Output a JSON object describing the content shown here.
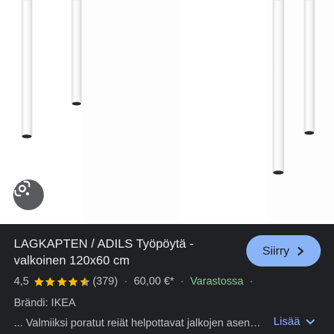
{
  "product": {
    "title": "LAGKAPTEN / ADILS Työpöytä - valkoinen 120x60 cm",
    "go_label": "Siirry",
    "rating": "4,5",
    "rating_value": 4.5,
    "rating_max": 5,
    "review_count": "(379)",
    "price": "60,00 €*",
    "availability": "Varastossa",
    "separator": "·",
    "brand_line": "Brändi: IKEA",
    "description": "... Valmiiksi poratut reiät helpottavat jalkojen asennusta",
    "more_label": "Lisää"
  },
  "icons": {
    "lens": "google-lens-icon",
    "go_chevron": "chevron-right-icon",
    "more_chevron": "chevron-down-icon",
    "star": "star-icon"
  },
  "colors": {
    "panel_bg": "#202124",
    "accent": "#8ab4f8",
    "star": "#fbbc04",
    "in_stock": "#81c995",
    "lens_bg": "#595a5e"
  }
}
